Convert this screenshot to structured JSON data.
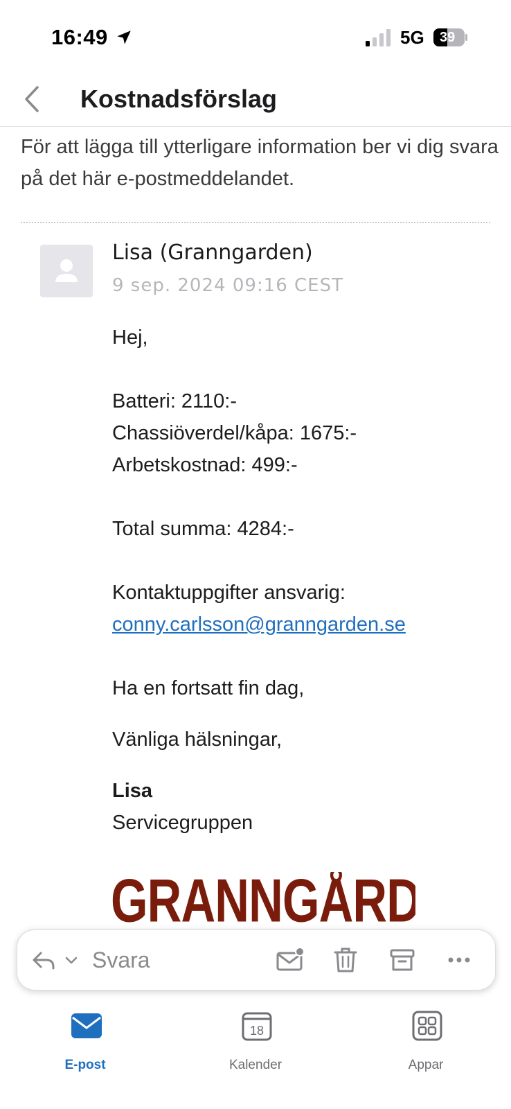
{
  "status_bar": {
    "time": "16:49",
    "network": "5G",
    "battery": "39"
  },
  "header": {
    "title": "Kostnadsförslag",
    "back_icon": "chevron-left-icon"
  },
  "email": {
    "info_text": "För att lägga till ytterligare information ber vi dig svara på det här e-postmeddelandet.",
    "sender": "Lisa (Granngarden)",
    "date": "9 sep. 2024 09:16 CEST",
    "greeting": "Hej,",
    "items": [
      "Batteri: 2110:-",
      "Chassiöverdel/kåpa: 1675:-",
      "Arbetskostnad: 499:-"
    ],
    "total": "Total summa: 4284:-",
    "contact_label": "Kontaktuppgifter ansvarig:",
    "contact_email": "conny.carlsson@granngarden.se",
    "closing": "Ha en fortsatt fin dag,",
    "regards": "Vänliga hälsningar,",
    "signature_name": "Lisa",
    "signature_team": "Servicegruppen",
    "logo_text": "GRANNGÅRDEN"
  },
  "reply_bar": {
    "reply_label": "Svara",
    "icons": [
      "reply-icon",
      "chevron-down-icon",
      "mark-unread-icon",
      "trash-icon",
      "archive-icon",
      "more-icon"
    ]
  },
  "tabs": [
    {
      "label": "E-post",
      "icon": "mail-icon",
      "active": true
    },
    {
      "label": "Kalender",
      "icon": "calendar-icon",
      "day": "18",
      "active": false
    },
    {
      "label": "Appar",
      "icon": "apps-grid-icon",
      "active": false
    }
  ],
  "colors": {
    "accent": "#1f6fbf",
    "logo": "#7a1c0b",
    "muted": "#8a8a8e"
  }
}
